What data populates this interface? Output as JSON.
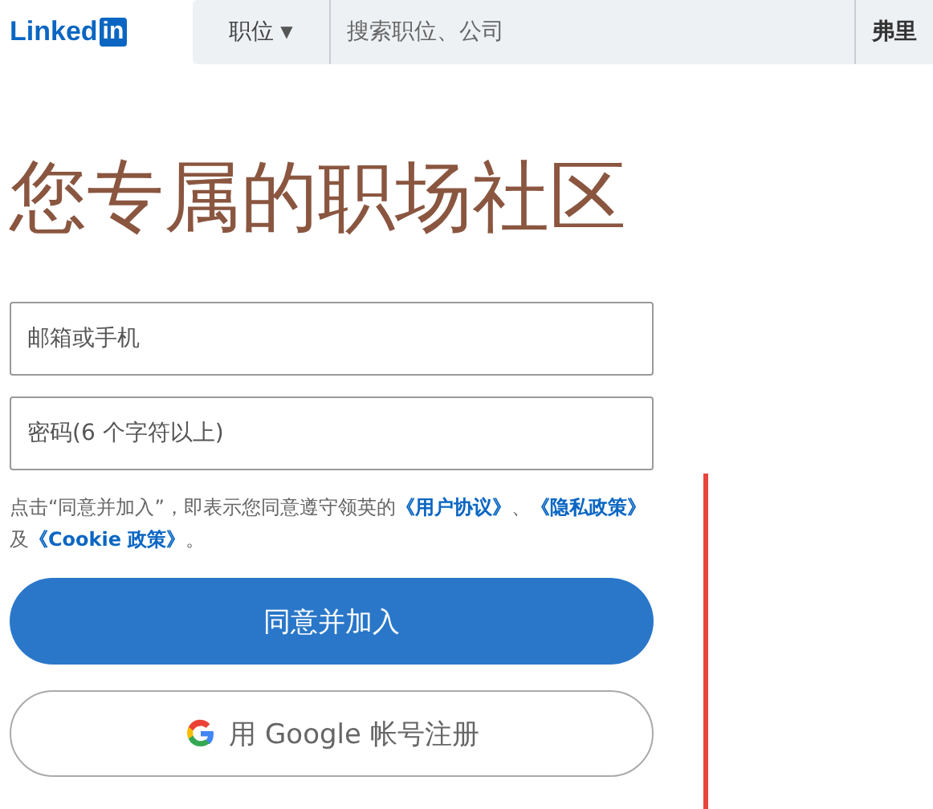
{
  "header": {
    "logo": {
      "text": "Linked",
      "badge": "in"
    },
    "category": {
      "label": "职位",
      "caret": "▼"
    },
    "search": {
      "placeholder": "搜索职位、公司"
    },
    "location": "弗里"
  },
  "title": "您专属的职场社区",
  "fields": [
    {
      "placeholder": "邮箱或手机"
    },
    {
      "placeholder": "密码(6 个字符以上)"
    }
  ],
  "terms": [
    {
      "kind": "text",
      "text": "点击“同意并加入”，即表示您同意遵守领英的"
    },
    {
      "kind": "link",
      "text": "《用户协议》"
    },
    {
      "kind": "text",
      "text": "、"
    },
    {
      "kind": "link",
      "text": "《隐私政策》"
    },
    {
      "kind": "text",
      "text": "及"
    },
    {
      "kind": "link",
      "text": "《Cookie 政策》"
    },
    {
      "kind": "text",
      "text": "。"
    }
  ],
  "buttons": [
    {
      "kind": "primary",
      "label": "同意并加入"
    },
    {
      "kind": "google",
      "label": "用 Google 帐号注册"
    }
  ]
}
